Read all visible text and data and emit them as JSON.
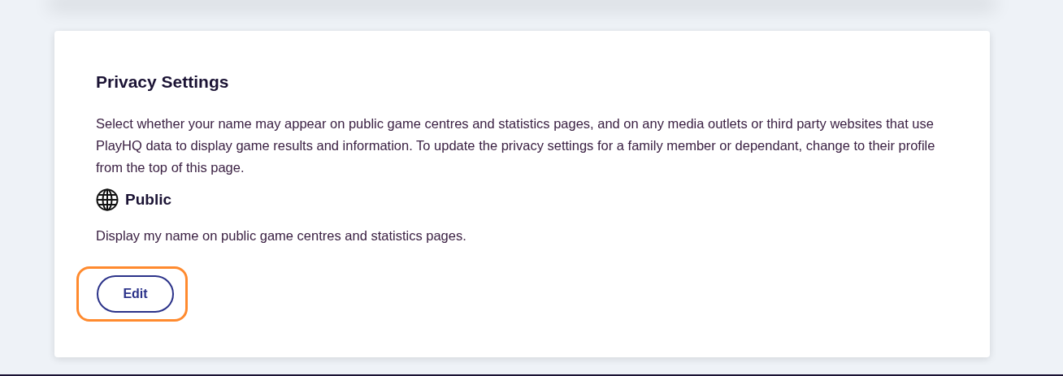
{
  "section": {
    "title": "Privacy Settings",
    "description": "Select whether your name may appear on public game centres and statistics pages, and on any media outlets or third party websites that use PlayHQ data to display game results and information. To update the privacy settings for a family member or dependant, change to their profile from the top of this page.",
    "setting": {
      "label": "Public",
      "detail": "Display my name on public game centres and statistics pages."
    },
    "edit_button": {
      "label": "Edit",
      "focused": true
    }
  }
}
